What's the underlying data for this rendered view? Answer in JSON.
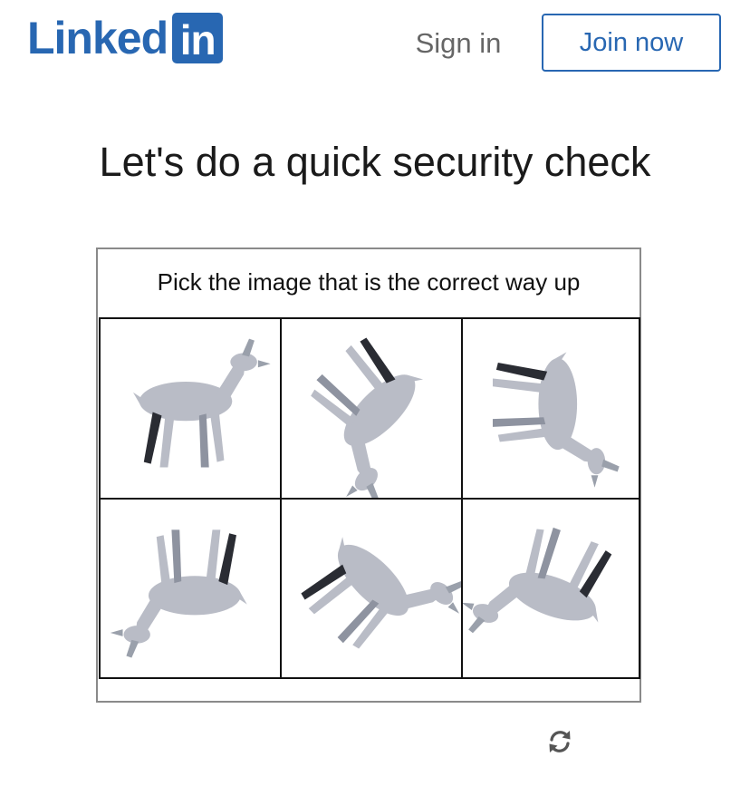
{
  "header": {
    "logo_word": "Linked",
    "logo_box": "in",
    "sign_in_label": "Sign in",
    "join_now_label": "Join now"
  },
  "page": {
    "title": "Let's do a quick security check"
  },
  "captcha": {
    "instruction": "Pick the image that is the correct way up",
    "tiles": [
      {
        "name": "captcha-tile-1",
        "rotation_deg": 0
      },
      {
        "name": "captcha-tile-2",
        "rotation_deg": 135
      },
      {
        "name": "captcha-tile-3",
        "rotation_deg": 90
      },
      {
        "name": "captcha-tile-4",
        "rotation_deg": 180
      },
      {
        "name": "captcha-tile-5",
        "rotation_deg": 45
      },
      {
        "name": "captcha-tile-6",
        "rotation_deg": 200
      }
    ],
    "refresh_icon": "refresh-icon"
  },
  "colors": {
    "brand": "#2867b2",
    "muted_text": "#666666",
    "animal_fill": "#b9bcc6",
    "animal_shadow": "#2a2c33"
  }
}
